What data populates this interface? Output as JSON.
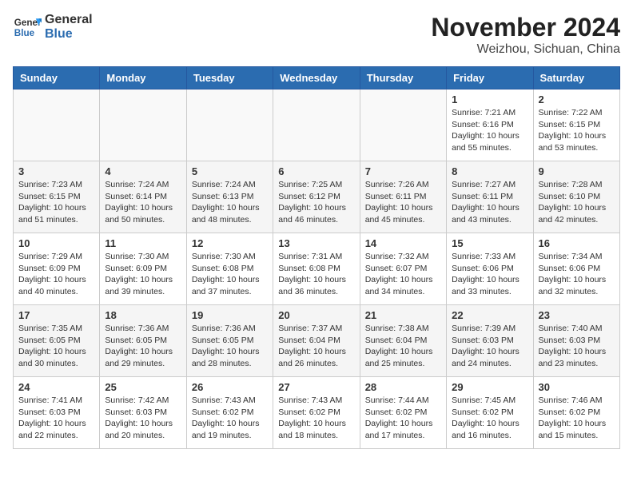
{
  "header": {
    "logo_line1": "General",
    "logo_line2": "Blue",
    "month": "November 2024",
    "location": "Weizhou, Sichuan, China"
  },
  "weekdays": [
    "Sunday",
    "Monday",
    "Tuesday",
    "Wednesday",
    "Thursday",
    "Friday",
    "Saturday"
  ],
  "weeks": [
    [
      {
        "day": "",
        "info": ""
      },
      {
        "day": "",
        "info": ""
      },
      {
        "day": "",
        "info": ""
      },
      {
        "day": "",
        "info": ""
      },
      {
        "day": "",
        "info": ""
      },
      {
        "day": "1",
        "info": "Sunrise: 7:21 AM\nSunset: 6:16 PM\nDaylight: 10 hours and 55 minutes."
      },
      {
        "day": "2",
        "info": "Sunrise: 7:22 AM\nSunset: 6:15 PM\nDaylight: 10 hours and 53 minutes."
      }
    ],
    [
      {
        "day": "3",
        "info": "Sunrise: 7:23 AM\nSunset: 6:15 PM\nDaylight: 10 hours and 51 minutes."
      },
      {
        "day": "4",
        "info": "Sunrise: 7:24 AM\nSunset: 6:14 PM\nDaylight: 10 hours and 50 minutes."
      },
      {
        "day": "5",
        "info": "Sunrise: 7:24 AM\nSunset: 6:13 PM\nDaylight: 10 hours and 48 minutes."
      },
      {
        "day": "6",
        "info": "Sunrise: 7:25 AM\nSunset: 6:12 PM\nDaylight: 10 hours and 46 minutes."
      },
      {
        "day": "7",
        "info": "Sunrise: 7:26 AM\nSunset: 6:11 PM\nDaylight: 10 hours and 45 minutes."
      },
      {
        "day": "8",
        "info": "Sunrise: 7:27 AM\nSunset: 6:11 PM\nDaylight: 10 hours and 43 minutes."
      },
      {
        "day": "9",
        "info": "Sunrise: 7:28 AM\nSunset: 6:10 PM\nDaylight: 10 hours and 42 minutes."
      }
    ],
    [
      {
        "day": "10",
        "info": "Sunrise: 7:29 AM\nSunset: 6:09 PM\nDaylight: 10 hours and 40 minutes."
      },
      {
        "day": "11",
        "info": "Sunrise: 7:30 AM\nSunset: 6:09 PM\nDaylight: 10 hours and 39 minutes."
      },
      {
        "day": "12",
        "info": "Sunrise: 7:30 AM\nSunset: 6:08 PM\nDaylight: 10 hours and 37 minutes."
      },
      {
        "day": "13",
        "info": "Sunrise: 7:31 AM\nSunset: 6:08 PM\nDaylight: 10 hours and 36 minutes."
      },
      {
        "day": "14",
        "info": "Sunrise: 7:32 AM\nSunset: 6:07 PM\nDaylight: 10 hours and 34 minutes."
      },
      {
        "day": "15",
        "info": "Sunrise: 7:33 AM\nSunset: 6:06 PM\nDaylight: 10 hours and 33 minutes."
      },
      {
        "day": "16",
        "info": "Sunrise: 7:34 AM\nSunset: 6:06 PM\nDaylight: 10 hours and 32 minutes."
      }
    ],
    [
      {
        "day": "17",
        "info": "Sunrise: 7:35 AM\nSunset: 6:05 PM\nDaylight: 10 hours and 30 minutes."
      },
      {
        "day": "18",
        "info": "Sunrise: 7:36 AM\nSunset: 6:05 PM\nDaylight: 10 hours and 29 minutes."
      },
      {
        "day": "19",
        "info": "Sunrise: 7:36 AM\nSunset: 6:05 PM\nDaylight: 10 hours and 28 minutes."
      },
      {
        "day": "20",
        "info": "Sunrise: 7:37 AM\nSunset: 6:04 PM\nDaylight: 10 hours and 26 minutes."
      },
      {
        "day": "21",
        "info": "Sunrise: 7:38 AM\nSunset: 6:04 PM\nDaylight: 10 hours and 25 minutes."
      },
      {
        "day": "22",
        "info": "Sunrise: 7:39 AM\nSunset: 6:03 PM\nDaylight: 10 hours and 24 minutes."
      },
      {
        "day": "23",
        "info": "Sunrise: 7:40 AM\nSunset: 6:03 PM\nDaylight: 10 hours and 23 minutes."
      }
    ],
    [
      {
        "day": "24",
        "info": "Sunrise: 7:41 AM\nSunset: 6:03 PM\nDaylight: 10 hours and 22 minutes."
      },
      {
        "day": "25",
        "info": "Sunrise: 7:42 AM\nSunset: 6:03 PM\nDaylight: 10 hours and 20 minutes."
      },
      {
        "day": "26",
        "info": "Sunrise: 7:43 AM\nSunset: 6:02 PM\nDaylight: 10 hours and 19 minutes."
      },
      {
        "day": "27",
        "info": "Sunrise: 7:43 AM\nSunset: 6:02 PM\nDaylight: 10 hours and 18 minutes."
      },
      {
        "day": "28",
        "info": "Sunrise: 7:44 AM\nSunset: 6:02 PM\nDaylight: 10 hours and 17 minutes."
      },
      {
        "day": "29",
        "info": "Sunrise: 7:45 AM\nSunset: 6:02 PM\nDaylight: 10 hours and 16 minutes."
      },
      {
        "day": "30",
        "info": "Sunrise: 7:46 AM\nSunset: 6:02 PM\nDaylight: 10 hours and 15 minutes."
      }
    ]
  ]
}
